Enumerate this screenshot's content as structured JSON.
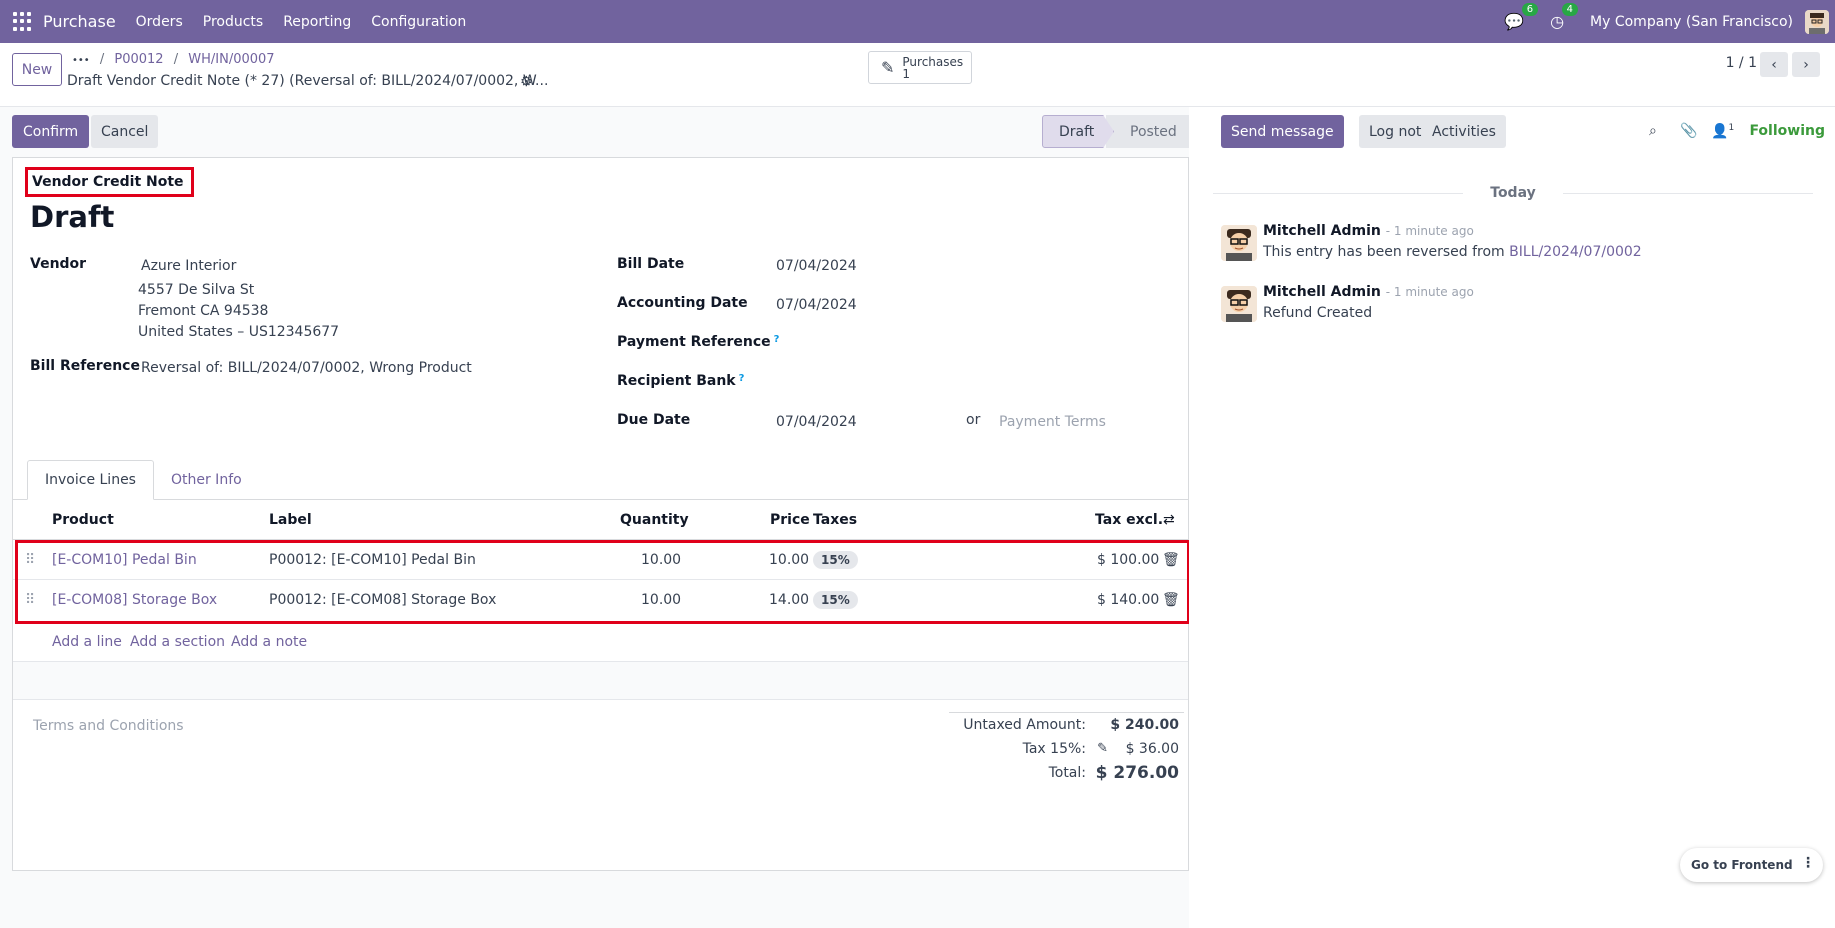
{
  "topbar": {
    "app_name": "Purchase",
    "menus": [
      "Orders",
      "Products",
      "Reporting",
      "Configuration"
    ],
    "messages_count": "6",
    "activities_count": "4",
    "company": "My Company (San Francisco)"
  },
  "control_panel": {
    "new_label": "New",
    "breadcrumb_more": "•••",
    "breadcrumb": [
      "P00012",
      "WH/IN/00007"
    ],
    "record_title": "Draft Vendor Credit Note (* 27) (Reversal of: BILL/2024/07/0002, W...",
    "smart_button_label": "Purchases",
    "smart_button_count": "1",
    "pager": "1 / 1"
  },
  "status_bar": {
    "confirm_label": "Confirm",
    "cancel_label": "Cancel",
    "stages": [
      "Draft",
      "Posted"
    ]
  },
  "form": {
    "move_type": "Vendor Credit Note",
    "state": "Draft",
    "vendor_label": "Vendor",
    "vendor_name": "Azure Interior",
    "vendor_street": "4557 De Silva St",
    "vendor_city": "Fremont CA 94538",
    "vendor_country": "United States – US12345677",
    "bill_reference_label": "Bill Reference",
    "bill_reference": "Reversal of: BILL/2024/07/0002, Wrong Product",
    "bill_date_label": "Bill Date",
    "bill_date": "07/04/2024",
    "accounting_date_label": "Accounting Date",
    "accounting_date": "07/04/2024",
    "payment_reference_label": "Payment Reference",
    "recipient_bank_label": "Recipient Bank",
    "help_mark": "?",
    "due_date_label": "Due Date",
    "due_date": "07/04/2024",
    "or_label": "or",
    "payment_terms_placeholder": "Payment Terms"
  },
  "tabs": [
    "Invoice Lines",
    "Other Info"
  ],
  "lines": {
    "headers": [
      "Product",
      "Label",
      "Quantity",
      "Price",
      "Taxes",
      "Tax excl."
    ],
    "rows": [
      {
        "product": "[E-COM10] Pedal Bin",
        "label": "P00012: [E-COM10] Pedal Bin",
        "quantity": "10.00",
        "price": "10.00",
        "tax": "15%",
        "subtotal": "$ 100.00"
      },
      {
        "product": "[E-COM08] Storage Box",
        "label": "P00012: [E-COM08] Storage Box",
        "quantity": "10.00",
        "price": "14.00",
        "tax": "15%",
        "subtotal": "$ 140.00"
      }
    ],
    "add_line": "Add a line",
    "add_section": "Add a section",
    "add_note": "Add a note"
  },
  "terms_placeholder": "Terms and Conditions",
  "totals": {
    "untaxed_label": "Untaxed Amount:",
    "untaxed": "$ 240.00",
    "tax_label": "Tax 15%:",
    "tax": "$ 36.00",
    "total_label": "Total:",
    "total": "$ 276.00"
  },
  "chatter": {
    "send_message": "Send message",
    "log_note": "Log note",
    "activities": "Activities",
    "followers_count": "1",
    "following": "Following",
    "day": "Today",
    "messages": [
      {
        "author": "Mitchell Admin",
        "time": "- 1 minute ago",
        "body_prefix": "This entry has been reversed from ",
        "body_link": "BILL/2024/07/0002"
      },
      {
        "author": "Mitchell Admin",
        "time": "- 1 minute ago",
        "body_prefix": "Refund Created",
        "body_link": ""
      }
    ]
  },
  "go_to_frontend": "Go to Frontend",
  "colors": {
    "brand": "#71639e",
    "highlight": "#e0001a",
    "success": "#28a745"
  }
}
